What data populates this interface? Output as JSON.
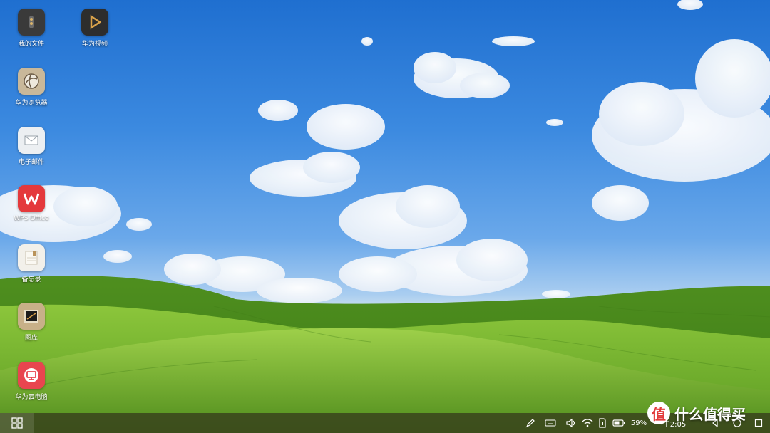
{
  "desktop": {
    "icons": [
      {
        "label": "我的文件",
        "icon": "folder-files-icon"
      },
      {
        "label": "华为视频",
        "icon": "play-video-icon"
      },
      {
        "label": "华为浏览器",
        "icon": "globe-browser-icon"
      },
      {
        "label": "电子邮件",
        "icon": "mail-envelope-icon"
      },
      {
        "label": "WPS Office",
        "icon": "wps-logo-icon"
      },
      {
        "label": "备忘录",
        "icon": "notepad-icon"
      },
      {
        "label": "图库",
        "icon": "photo-gallery-icon"
      },
      {
        "label": "华为云电脑",
        "icon": "cloud-pc-icon"
      }
    ]
  },
  "taskbar": {
    "start_icon": "app-grid-icon",
    "battery_percent": "59%",
    "time": "下午2:05",
    "tray_icons": [
      "stylus-icon",
      "keyboard-icon",
      "volume-icon",
      "wifi-icon",
      "sim-card-icon",
      "battery-icon"
    ],
    "nav_icons": [
      "back-triangle-icon",
      "home-circle-icon",
      "recents-square-icon"
    ]
  },
  "watermark": {
    "logo_char": "值",
    "text": "什么值得买"
  },
  "colors": {
    "sky": "#3c8ae0",
    "grass": "#6fae2e",
    "taskbar": "#3a461c",
    "wps_red": "#e4393c",
    "cloud_pc_red": "#e8454f"
  }
}
